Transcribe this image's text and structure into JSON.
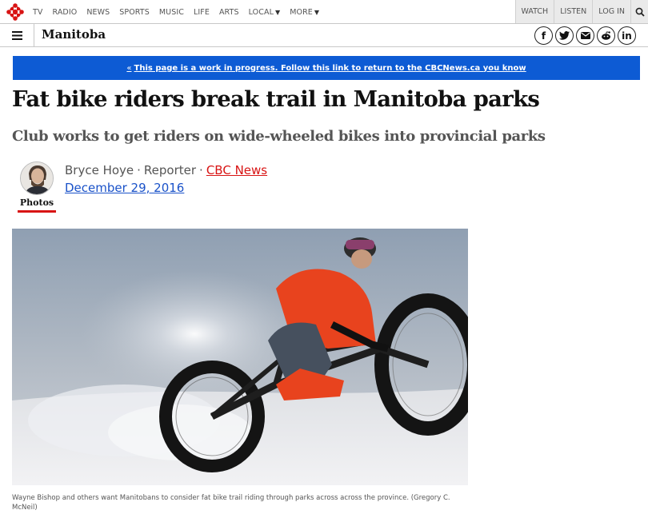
{
  "nav": {
    "items": [
      "TV",
      "RADIO",
      "NEWS",
      "SPORTS",
      "MUSIC",
      "LIFE",
      "ARTS"
    ],
    "local_label": "LOCAL",
    "more_label": "MORE",
    "watch_label": "WATCH",
    "listen_label": "LISTEN",
    "login_label": "LOG IN"
  },
  "section": {
    "title": "Manitoba",
    "social": [
      "f",
      "t",
      "m",
      "r",
      "in"
    ]
  },
  "banner": {
    "prefix": "«",
    "text": "This page is a work in progress. Follow this link to return to the CBCNews.ca you know"
  },
  "article": {
    "headline": "Fat bike riders break trail in Manitoba parks",
    "subheadline": "Club works to get riders on wide-wheeled bikes into provincial parks",
    "author": "Bryce Hoye",
    "role": "Reporter",
    "source": "CBC News",
    "date": "December 29, 2016",
    "photos_label": "Photos",
    "caption": "Wayne Bishop and others want Manitobans to consider fat bike trail riding through parks across across the province. (Gregory C. McNeil)"
  },
  "colors": {
    "brand_red": "#d81414",
    "banner_blue": "#0d5bd4",
    "link_blue": "#1a52c9"
  }
}
